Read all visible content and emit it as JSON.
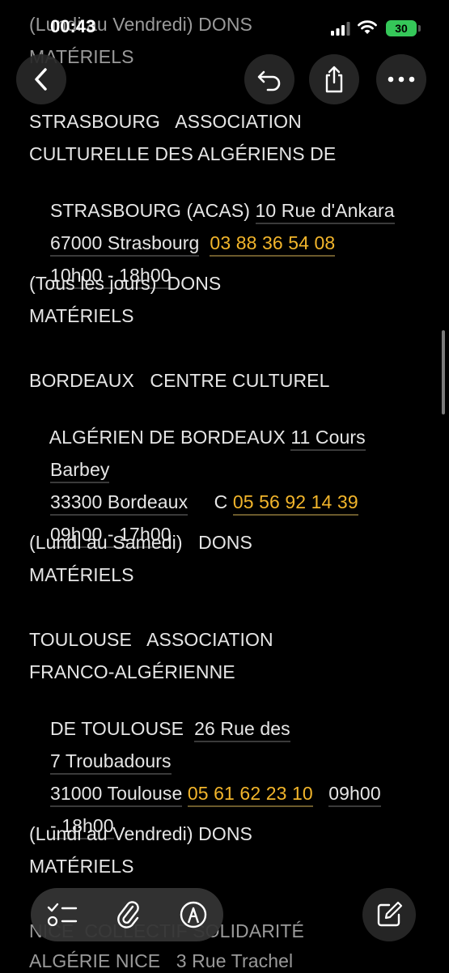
{
  "status_bar": {
    "time": "00:43",
    "battery": "30"
  },
  "header_fragment": {
    "line1": "(Lundi au Vendredi) DONS",
    "line2": "MATÉRIELS"
  },
  "entries": [
    {
      "lines": [
        "STRASBOURG   ASSOCIATION",
        "CULTURELLE DES ALGÉRIENS DE",
        "STRASBOURG (ACAS) "
      ],
      "address1": "10 Rue d'Ankara",
      "address2": "67000 Strasbourg",
      "phone": "03 88 36 54 08",
      "hours": "10h00 - 18h00",
      "days": "(Tous les jours)  DONS",
      "type": "MATÉRIELS"
    },
    {
      "lines": [
        "BORDEAUX   CENTRE CULTUREL",
        "ALGÉRIEN DE BORDEAUX "
      ],
      "address1": "11 Cours",
      "address1b": "Barbey",
      "address2": "33300 Bordeaux",
      "between": "     C ",
      "phone": "05 56 92 14 39",
      "hours": "09h00 - 17h00",
      "days": "(Lundi au Samedi)   DONS",
      "type": "MATÉRIELS"
    },
    {
      "lines": [
        "TOULOUSE   ASSOCIATION",
        "FRANCO-ALGÉRIENNE",
        "DE TOULOUSE  "
      ],
      "address1": "26 Rue des",
      "address1b": "7 Troubadours",
      "address2": "31000 Toulouse",
      "phone": "05 61 62 23 10",
      "hours_a": "09h00",
      "hours_b": "- 18h00",
      "days": "(Lundi au Vendredi) DONS",
      "type": "MATÉRIELS"
    }
  ],
  "partial_bottom": {
    "line1": "NICE  COLLECTIF SOLIDARITÉ",
    "line2": "ALGÉRIE NICE   3 Rue Trachel"
  },
  "nav": {
    "back_icon": "chevron-left",
    "undo_icon": "undo",
    "share_icon": "share",
    "more_icon": "ellipsis"
  },
  "toolbar": {
    "checklist_icon": "checklist",
    "attach_icon": "paperclip",
    "markup_icon": "markup-pen",
    "compose_icon": "compose"
  },
  "colors": {
    "phone": "#f2b52b",
    "battery": "#35c759"
  }
}
